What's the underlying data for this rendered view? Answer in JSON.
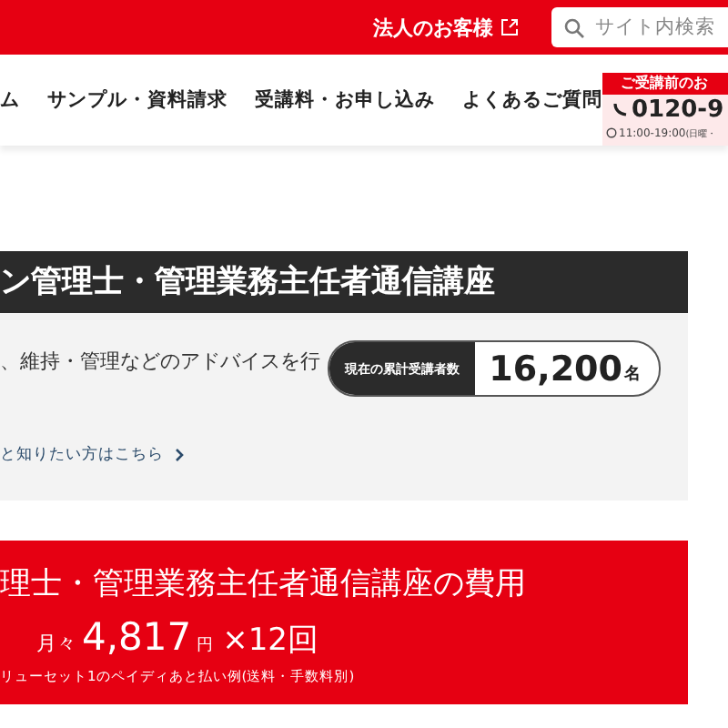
{
  "top_bar": {
    "corporate_link": "法人のお客様",
    "search": {
      "placeholder": "サイト内検索"
    }
  },
  "nav": {
    "items": [
      "ム",
      "サンプル・資料請求",
      "受講料・お申し込み",
      "よくあるご質問"
    ],
    "contact": {
      "heading": "ご受講前のお",
      "phone": "0120-9",
      "hours": "11:00-19:00",
      "hours_note": "(日曜・"
    }
  },
  "course": {
    "title": "ン管理士・管理業務主任者通信講座",
    "description": "、維持・管理などのアドバイスを行",
    "counter_label": "現在の累計受講者数",
    "counter_value": "16,200",
    "counter_unit": "名",
    "link": "と知りたい方はこちら"
  },
  "price": {
    "title": "理士・管理業務主任者通信講座の費用",
    "prefix": "月々",
    "amount": "4,817",
    "unit": "円",
    "times": "×12回",
    "note": "リューセット1のペイディあと払い例(送料・手数料別)"
  }
}
